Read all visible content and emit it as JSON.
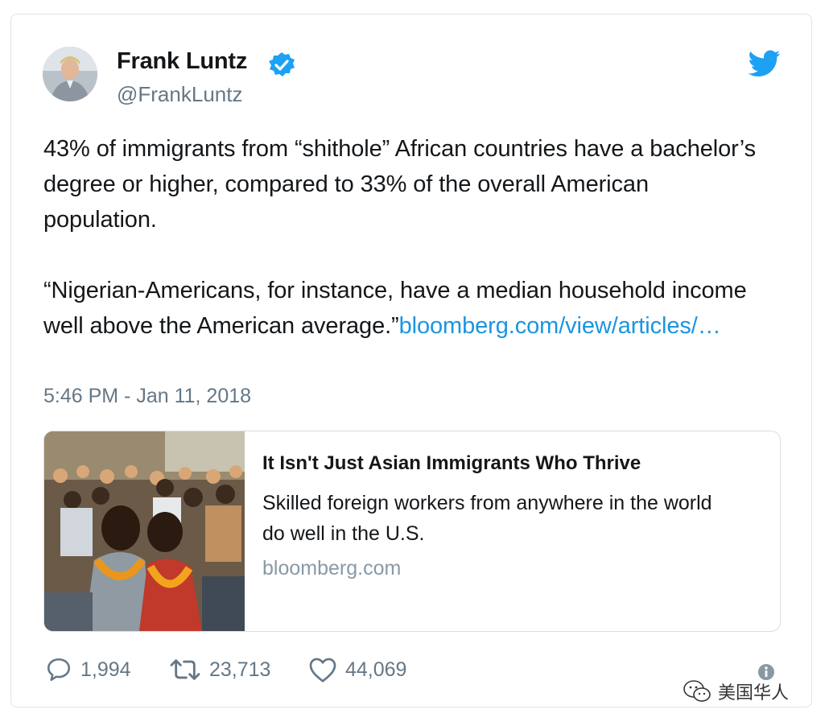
{
  "author": {
    "name": "Frank Luntz",
    "handle": "@FrankLuntz",
    "verified": true
  },
  "tweet": {
    "paragraph1": "43% of immigrants from “shithole” African countries have a bachelor’s degree or higher, compared to 33% of the overall American population.",
    "paragraph2_text": "“Nigerian-Americans, for instance, have a median household income well above the American average.”",
    "link_text": "bloomberg.com/view/articles/…",
    "timestamp": "5:46 PM - Jan 11, 2018"
  },
  "link_card": {
    "title": "It Isn't Just Asian Immigrants Who Thrive",
    "description": "Skilled foreign workers from anywhere in the world do well in the U.S.",
    "domain": "bloomberg.com"
  },
  "actions": {
    "replies": "1,994",
    "retweets": "23,713",
    "likes": "44,069"
  },
  "watermark": {
    "text": "美国华人"
  },
  "icons": {
    "verified": "verified-badge-icon",
    "bird": "twitter-bird-icon",
    "reply": "reply-icon",
    "retweet": "retweet-icon",
    "like": "heart-icon",
    "info": "info-icon",
    "wechat": "wechat-icon"
  },
  "colors": {
    "accent": "#1da1f2",
    "link": "#1b95e0",
    "muted": "#657786",
    "text": "#14171a"
  }
}
